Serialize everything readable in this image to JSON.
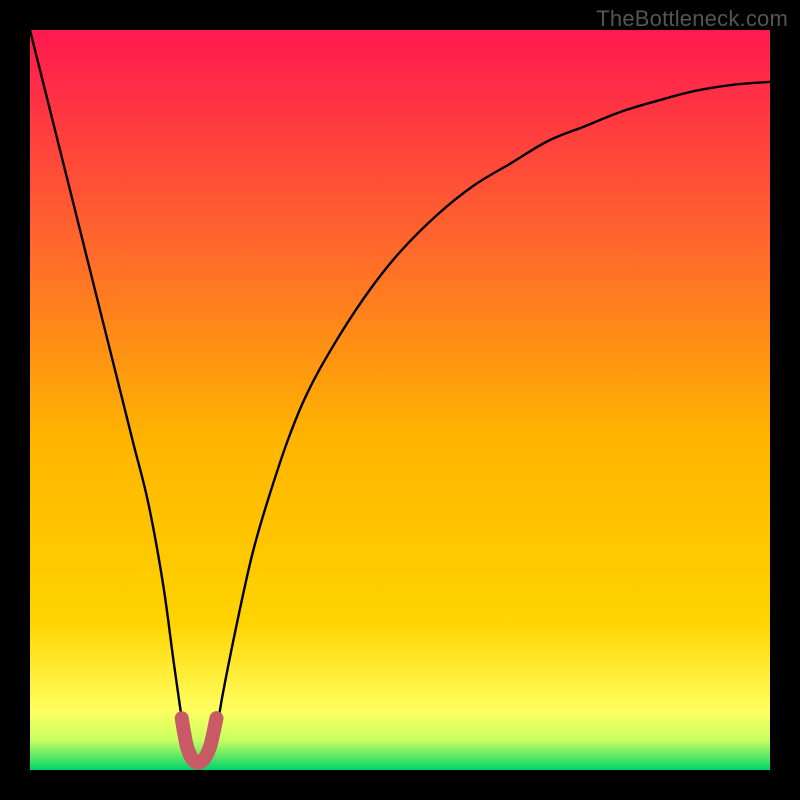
{
  "watermark": "TheBottleneck.com",
  "chart_data": {
    "type": "line",
    "title": "",
    "xlabel": "",
    "ylabel": "",
    "xlim": [
      0,
      100
    ],
    "ylim": [
      0,
      100
    ],
    "grid": false,
    "legend": false,
    "background_gradient": {
      "top": "#ff1850",
      "mid": "#ffd400",
      "bottom": "#ffff60",
      "base": "#00d46a"
    },
    "series": [
      {
        "name": "bottleneck-curve",
        "color": "#000000",
        "x": [
          0,
          2,
          4,
          6,
          8,
          10,
          12,
          14,
          16,
          18,
          19.5,
          21,
          22,
          23,
          24,
          25,
          26,
          28,
          30,
          32,
          35,
          38,
          42,
          46,
          50,
          55,
          60,
          65,
          70,
          75,
          80,
          85,
          90,
          95,
          100
        ],
        "y": [
          100,
          92,
          84,
          76,
          68,
          60,
          52,
          44,
          36,
          25,
          14,
          4,
          1,
          0.5,
          1,
          4,
          10,
          20,
          29,
          36,
          45,
          52,
          59,
          65,
          70,
          75,
          79,
          82,
          85,
          87,
          89,
          90.5,
          91.8,
          92.6,
          93
        ]
      },
      {
        "name": "target-highlight",
        "color": "#c75a64",
        "highlight": true,
        "x": [
          20.5,
          21.2,
          22,
          22.8,
          23.6,
          24.4,
          25.2
        ],
        "y": [
          7,
          3.2,
          1.4,
          1.0,
          1.6,
          3.4,
          7
        ]
      }
    ]
  }
}
